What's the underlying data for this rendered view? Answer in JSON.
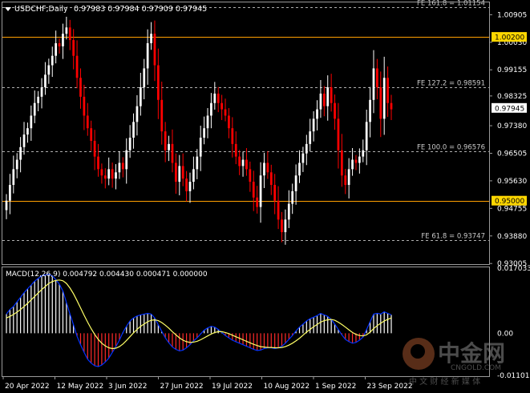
{
  "header": {
    "symbol": "USDCHF,Daily",
    "ohlc": "0.97983 0.97984 0.97909 0.97945"
  },
  "colors": {
    "bull": "#ffffff",
    "bear": "#ff0000",
    "level_line": "#ffa000",
    "price_badge_bg": "#ffd700",
    "current_badge_bg": "#ffffff",
    "macd_signal": "#ffff66",
    "macd_main": "#0033ff",
    "hist_bear": "#ff2a2a"
  },
  "chart_data": [
    {
      "type": "candlestick",
      "title": "USDCHF,Daily",
      "ylim": [
        0.9301,
        1.0127
      ],
      "y_ticks": [
        "1.00905",
        "1.00030",
        "0.99155",
        "0.98325",
        "0.97380",
        "0.96505",
        "0.95630",
        "0.94755",
        "0.93880",
        "0.93005"
      ],
      "x_ticks": [
        "20 Apr 2022",
        "12 May 2022",
        "3 Jun 2022",
        "27 Jun 2022",
        "19 Jul 2022",
        "10 Aug 2022",
        "1 Sep 2022",
        "23 Sep 2022"
      ],
      "grid": false,
      "fib_levels": [
        {
          "label": "FE 161.8 = 1.01154",
          "value": 1.01154
        },
        {
          "label": "FE 127.2 = 0.98591",
          "value": 0.98591
        },
        {
          "label": "FE 100.0 = 0.96576",
          "value": 0.96576
        },
        {
          "label": "FE 61.8 = 0.93747",
          "value": 0.93747
        }
      ],
      "levels": [
        {
          "label": "1.00200",
          "value": 1.002
        },
        {
          "label": "0.95000",
          "value": 0.95
        }
      ],
      "current_price": {
        "label": "0.97945",
        "value": 0.97945
      },
      "closes": [
        0.95,
        0.955,
        0.96,
        0.963,
        0.967,
        0.971,
        0.973,
        0.977,
        0.981,
        0.983,
        0.986,
        0.99,
        0.993,
        0.996,
        1.0,
        0.999,
        1.003,
        1.005,
        1.001,
        0.996,
        0.989,
        0.983,
        0.977,
        0.973,
        0.969,
        0.964,
        0.96,
        0.958,
        0.957,
        0.96,
        0.957,
        0.959,
        0.962,
        0.96,
        0.966,
        0.97,
        0.975,
        0.98,
        0.986,
        0.992,
        1.0,
        1.003,
        0.993,
        0.982,
        0.972,
        0.966,
        0.968,
        0.962,
        0.956,
        0.961,
        0.957,
        0.953,
        0.956,
        0.96,
        0.964,
        0.97,
        0.973,
        0.977,
        0.981,
        0.984,
        0.981,
        0.979,
        0.977,
        0.973,
        0.968,
        0.964,
        0.961,
        0.963,
        0.96,
        0.956,
        0.951,
        0.948,
        0.958,
        0.962,
        0.959,
        0.955,
        0.95,
        0.944,
        0.94,
        0.944,
        0.949,
        0.953,
        0.958,
        0.962,
        0.965,
        0.968,
        0.972,
        0.976,
        0.979,
        0.984,
        0.98,
        0.986,
        0.981,
        0.976,
        0.966,
        0.958,
        0.955,
        0.96,
        0.963,
        0.962,
        0.964,
        0.966,
        0.975,
        0.982,
        0.992,
        0.986,
        0.976,
        0.989,
        0.981,
        0.979
      ]
    },
    {
      "type": "histogram",
      "title": "MACD(12,26,9) 0.004792 0.004430 0.000471 0.000000",
      "ylim": [
        -0.011,
        0.017
      ],
      "y_ticks": [
        "0.017033",
        "0.00",
        "-0.011018"
      ],
      "series": [
        {
          "name": "0.004792",
          "values": [
            0.005,
            0.0062,
            0.007,
            0.0082,
            0.0094,
            0.0106,
            0.0116,
            0.0126,
            0.0136,
            0.0143,
            0.015,
            0.0152,
            0.0154,
            0.015,
            0.014,
            0.0128,
            0.011,
            0.008,
            0.005,
            0.0022,
            -0.0008,
            -0.003,
            -0.005,
            -0.0068,
            -0.0078,
            -0.0085,
            -0.0087,
            -0.0083,
            -0.0075,
            -0.0065,
            -0.005,
            -0.0035,
            -0.0018,
            0.0002,
            0.0018,
            0.0032,
            0.004,
            0.0045,
            0.0048,
            0.005,
            0.0052,
            0.005,
            0.004,
            0.0022,
            0.0005,
            -0.0012,
            -0.0025,
            -0.0036,
            -0.0042,
            -0.0046,
            -0.0044,
            -0.0038,
            -0.003,
            -0.002,
            -0.0012,
            -0.0002,
            0.0008,
            0.0014,
            0.0018,
            0.0016,
            0.001,
            0.0002,
            -0.0006,
            -0.0012,
            -0.0018,
            -0.0022,
            -0.0026,
            -0.003,
            -0.0034,
            -0.0038,
            -0.0042,
            -0.0045,
            -0.0044,
            -0.004,
            -0.0038,
            -0.0038,
            -0.004,
            -0.0038,
            -0.0034,
            -0.0026,
            -0.0016,
            -0.0006,
            0.0006,
            0.0016,
            0.0024,
            0.0032,
            0.0038,
            0.0042,
            0.0046,
            0.0052,
            0.0048,
            0.0044,
            0.0036,
            0.0024,
            0.001,
            -0.0004,
            -0.0016,
            -0.0022,
            -0.0026,
            -0.0024,
            -0.0018,
            -0.001,
            0.001,
            0.003,
            0.005,
            0.0052,
            0.005,
            0.0056,
            0.0052,
            0.0048
          ]
        },
        {
          "name": "0.004430",
          "values": [
            0.004,
            0.0044,
            0.0049,
            0.0055,
            0.0062,
            0.007,
            0.0078,
            0.0087,
            0.0096,
            0.0105,
            0.0114,
            0.0122,
            0.013,
            0.0135,
            0.0138,
            0.0139,
            0.0137,
            0.013,
            0.0118,
            0.0103,
            0.0085,
            0.0066,
            0.0047,
            0.0029,
            0.0012,
            -0.0003,
            -0.0016,
            -0.0026,
            -0.0033,
            -0.0038,
            -0.004,
            -0.0039,
            -0.0035,
            -0.0028,
            -0.0019,
            -0.0009,
            0.0001,
            0.001,
            0.0018,
            0.0024,
            0.003,
            0.0034,
            0.0035,
            0.0033,
            0.0028,
            0.0021,
            0.0013,
            0.0004,
            -0.0004,
            -0.0012,
            -0.0018,
            -0.0022,
            -0.0024,
            -0.0023,
            -0.0021,
            -0.0017,
            -0.0012,
            -0.0007,
            -0.0002,
            0.0002,
            0.0004,
            0.0004,
            0.0002,
            -0.0001,
            -0.0005,
            -0.0009,
            -0.0013,
            -0.0017,
            -0.0021,
            -0.0025,
            -0.0029,
            -0.0032,
            -0.0035,
            -0.0036,
            -0.0037,
            -0.0037,
            -0.0038,
            -0.0038,
            -0.0037,
            -0.0035,
            -0.0031,
            -0.0026,
            -0.002,
            -0.0013,
            -0.0005,
            0.0003,
            0.001,
            0.0017,
            0.0023,
            0.0029,
            0.0033,
            0.0035,
            0.0036,
            0.0034,
            0.0029,
            0.0023,
            0.0016,
            0.0009,
            0.0002,
            -0.0003,
            -0.0006,
            -0.0007,
            -0.0004,
            0.0003,
            0.0012,
            0.002,
            0.0026,
            0.0032,
            0.0036,
            0.004
          ]
        }
      ]
    }
  ],
  "watermark": {
    "brand": "中金网",
    "domain": "CNGOLD.COM",
    "tagline": "中 文 财 经 新 媒 体"
  }
}
